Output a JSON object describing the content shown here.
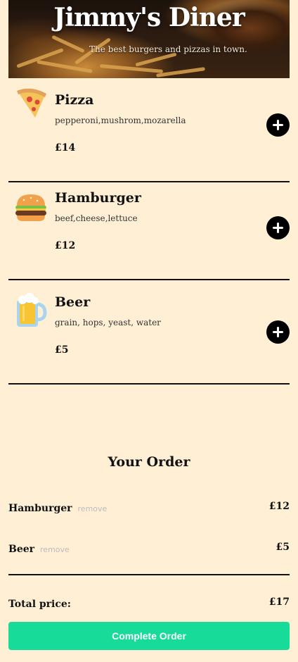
{
  "header": {
    "title": "Jimmy's Diner",
    "subtitle": "The best burgers and pizzas in town."
  },
  "menu": [
    {
      "icon": "pizza-icon",
      "name": "Pizza",
      "ingredients": "pepperoni,mushrom,mozarella",
      "price": "£14"
    },
    {
      "icon": "hamburger-icon",
      "name": "Hamburger",
      "ingredients": "beef,cheese,lettuce",
      "price": "£12"
    },
    {
      "icon": "beer-icon",
      "name": "Beer",
      "ingredients": "grain, hops, yeast, water",
      "price": "£5"
    }
  ],
  "order": {
    "title": "Your Order",
    "remove_label": "remove",
    "items": [
      {
        "name": "Hamburger",
        "price": "£12"
      },
      {
        "name": "Beer",
        "price": "£5"
      }
    ],
    "total_label": "Total price:",
    "total_price": "£17",
    "complete_label": "Complete Order"
  },
  "colors": {
    "background": "#feefd5",
    "accent": "#16db99"
  }
}
